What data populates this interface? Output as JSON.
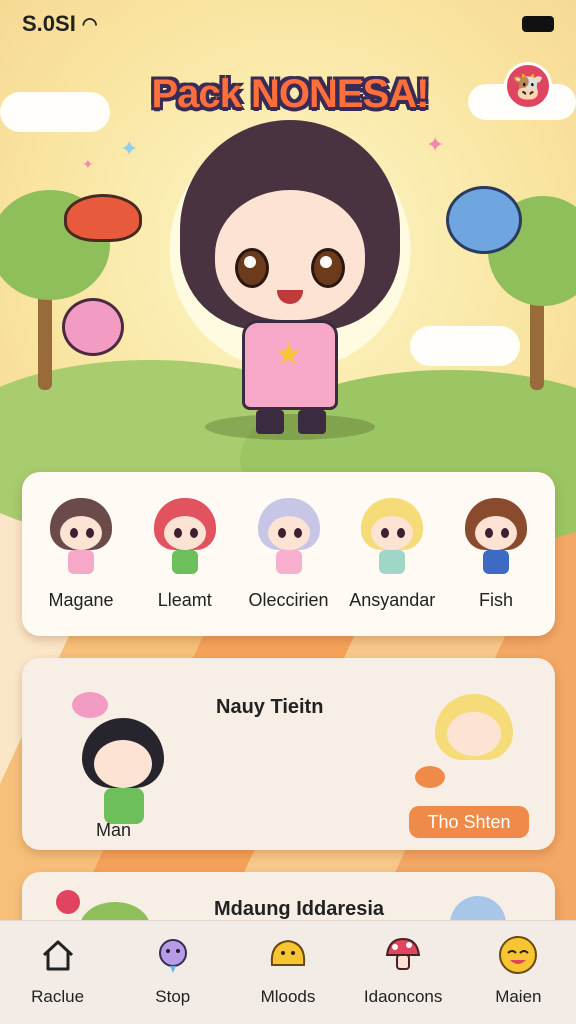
{
  "status": {
    "time": "S.0SI",
    "wifi_icon": "wifi-icon",
    "battery_icon": "battery-icon"
  },
  "hero": {
    "title": "Pack NONESA!",
    "avatar_icon": "profile-icon"
  },
  "characters": [
    {
      "name": "Magane",
      "hair": "#6a4b4a",
      "outfit": "#f7a8c8"
    },
    {
      "name": "Lleamt",
      "hair": "#e2535f",
      "outfit": "#6cbf5a"
    },
    {
      "name": "Oleccirien",
      "hair": "#c8c6e6",
      "outfit": "#f9b0cf"
    },
    {
      "name": "Ansyandar",
      "hair": "#f5dc78",
      "outfit": "#9fd6c8"
    },
    {
      "name": "Fish",
      "hair": "#8a4a2e",
      "outfit": "#3d6bc3"
    }
  ],
  "feature": {
    "title": "Nauy Tieitn",
    "left_name": "Man",
    "button_label": "Tho Shten"
  },
  "feature2": {
    "title": "Mdaung Iddaresia"
  },
  "tabs": [
    {
      "label": "Raclue",
      "icon": "home-icon"
    },
    {
      "label": "Stop",
      "icon": "creature-icon"
    },
    {
      "label": "Mloods",
      "icon": "pudding-icon"
    },
    {
      "label": "Idaoncons",
      "icon": "mushroom-icon"
    },
    {
      "label": "Maien",
      "icon": "smile-face-icon"
    }
  ],
  "colors": {
    "accent": "#f08a48",
    "title": "#ff6f3c",
    "profile": "#e0445e"
  }
}
